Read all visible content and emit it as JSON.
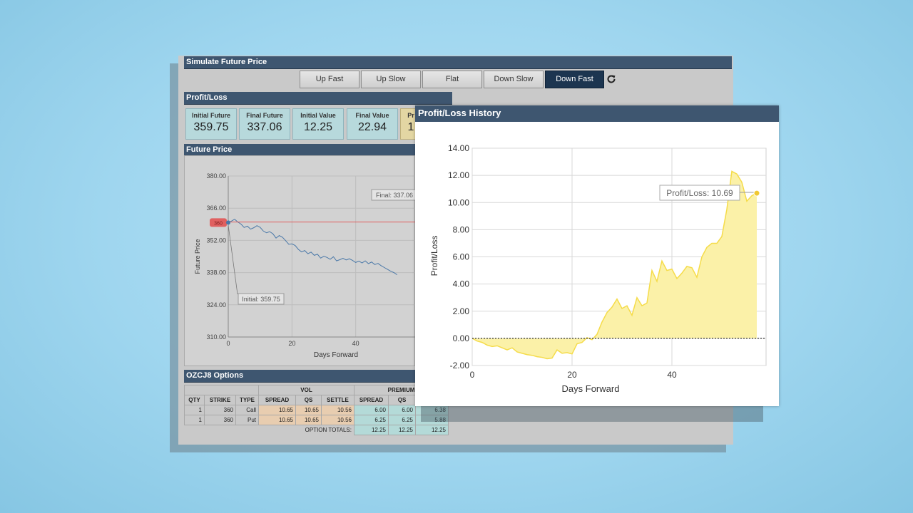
{
  "simulate": {
    "title": "Simulate Future Price",
    "buttons": [
      "Up Fast",
      "Up Slow",
      "Flat",
      "Down Slow",
      "Down Fast"
    ],
    "active": "Down Fast",
    "refresh_icon": "refresh-icon"
  },
  "profit_loss": {
    "title": "Profit/Loss",
    "cards": [
      {
        "label": "Initial Future",
        "value": "359.75"
      },
      {
        "label": "Final Future",
        "value": "337.06"
      },
      {
        "label": "Initial Value",
        "value": "12.25"
      },
      {
        "label": "Final Value",
        "value": "22.94"
      },
      {
        "label": "Pr",
        "value": "1"
      }
    ]
  },
  "future_price": {
    "title": "Future Price",
    "tooltip_final": "Final: 337.06",
    "tooltip_initial": "Initial: 359.75",
    "marker_label": "360"
  },
  "options": {
    "title": "OZCJ8 Options",
    "group_headers": {
      "vol": "VOL",
      "premium": "PREMIUM"
    },
    "columns": [
      "QTY",
      "STRIKE",
      "TYPE",
      "SPREAD",
      "QS",
      "SETTLE",
      "SPREAD",
      "QS",
      ""
    ],
    "rows": [
      [
        "1",
        "360",
        "Call",
        "10.65",
        "10.65",
        "10.56",
        "6.00",
        "6.00",
        "6.38"
      ],
      [
        "1",
        "360",
        "Put",
        "10.65",
        "10.65",
        "10.56",
        "6.25",
        "6.25",
        "5.88"
      ]
    ],
    "totals_label": "OPTION TOTALS:",
    "totals": [
      "12.25",
      "12.25",
      "12.25"
    ]
  },
  "popup": {
    "title": "Profit/Loss History",
    "tooltip": "Profit/Loss: 10.69"
  },
  "colors": {
    "header": "#3e5670",
    "active_button": "#1c3550",
    "pl_line": "#f5dc4a",
    "pl_fill": "#fbf1a8",
    "price_line": "#4a78a8",
    "ref_line": "#e06060"
  },
  "chart_data": [
    {
      "type": "line",
      "title": "",
      "xlabel": "Days Forward",
      "ylabel": "Future Price",
      "xlim": [
        0,
        60
      ],
      "ylim": [
        310,
        380
      ],
      "xticks": [
        "0",
        "20",
        "40"
      ],
      "yticks": [
        "310.00",
        "324.00",
        "338.00",
        "352.00",
        "366.00",
        "380.00"
      ],
      "reference_line": 360,
      "x": [
        0,
        1,
        2,
        3,
        4,
        5,
        6,
        7,
        8,
        9,
        10,
        11,
        12,
        13,
        14,
        15,
        16,
        17,
        18,
        19,
        20,
        21,
        22,
        23,
        24,
        25,
        26,
        27,
        28,
        29,
        30,
        31,
        32,
        33,
        34,
        35,
        36,
        37,
        38,
        39,
        40,
        41,
        42,
        43,
        44,
        45,
        46,
        47,
        48,
        49,
        50,
        51,
        52,
        53
      ],
      "values": [
        359.75,
        360.4,
        361.2,
        360.0,
        359.1,
        357.6,
        358.2,
        356.9,
        357.5,
        358.4,
        357.7,
        356.1,
        355.3,
        355.8,
        354.9,
        353.0,
        354.1,
        353.4,
        351.9,
        350.3,
        350.5,
        349.8,
        348.1,
        347.0,
        347.6,
        346.2,
        346.9,
        345.5,
        346.0,
        344.3,
        345.1,
        344.6,
        343.8,
        344.9,
        343.1,
        343.6,
        344.2,
        343.5,
        344.0,
        343.3,
        342.4,
        343.0,
        342.2,
        343.1,
        341.9,
        342.6,
        341.5,
        342.0,
        341.0,
        340.2,
        339.4,
        338.6,
        338.0,
        337.06
      ]
    },
    {
      "type": "area",
      "title": "",
      "xlabel": "Days Forward",
      "ylabel": "Profit/Loss",
      "xlim": [
        0,
        60
      ],
      "ylim": [
        -2,
        14
      ],
      "xticks": [
        "0",
        "20",
        "40"
      ],
      "yticks": [
        "-2.00",
        "0.00",
        "2.00",
        "4.00",
        "6.00",
        "8.00",
        "10.00",
        "12.00",
        "14.00"
      ],
      "x": [
        0,
        1,
        2,
        3,
        4,
        5,
        6,
        7,
        8,
        9,
        10,
        11,
        12,
        13,
        14,
        15,
        16,
        17,
        18,
        19,
        20,
        21,
        22,
        23,
        24,
        25,
        26,
        27,
        28,
        29,
        30,
        31,
        32,
        33,
        34,
        35,
        36,
        37,
        38,
        39,
        40,
        41,
        42,
        43,
        44,
        45,
        46,
        47,
        48,
        49,
        50,
        51,
        52,
        53,
        54,
        55,
        56,
        57
      ],
      "values": [
        0,
        -0.2,
        -0.3,
        -0.5,
        -0.6,
        -0.55,
        -0.7,
        -0.85,
        -0.7,
        -1.0,
        -1.1,
        -1.2,
        -1.25,
        -1.35,
        -1.4,
        -1.5,
        -1.45,
        -0.85,
        -1.1,
        -1.05,
        -1.15,
        -0.4,
        -0.3,
        0.05,
        -0.1,
        0.3,
        1.2,
        1.9,
        2.3,
        2.9,
        2.2,
        2.4,
        1.7,
        3.0,
        2.4,
        2.6,
        5.0,
        4.2,
        5.7,
        5.0,
        5.1,
        4.4,
        4.8,
        5.3,
        5.2,
        4.5,
        6.0,
        6.7,
        7.0,
        7.0,
        7.5,
        9.5,
        12.3,
        12.1,
        11.5,
        10.1,
        10.5,
        10.69
      ]
    }
  ]
}
